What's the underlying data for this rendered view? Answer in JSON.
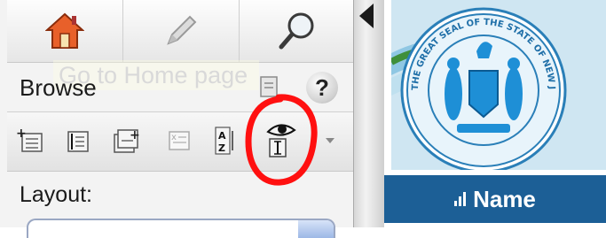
{
  "nav": {
    "home_icon": "home-icon",
    "edit_icon": "pencil-icon",
    "search_icon": "magnifier-icon"
  },
  "tooltip": {
    "text": "Go to Home page"
  },
  "browse": {
    "label": "Browse",
    "help": "?"
  },
  "toolbar": {
    "icons": [
      "new-record-icon",
      "edit-record-icon",
      "add-related-icon",
      "delete-record-icon",
      "sort-az-icon",
      "view-field-icon"
    ]
  },
  "layout": {
    "label": "Layout:"
  },
  "right": {
    "image": "state-seal-image",
    "column_header": "Name",
    "seal_text": "THE GREAT SEAL OF THE STATE OF NEW JERSEY"
  },
  "colors": {
    "header_blue": "#1c5f96",
    "annotation_red": "#ff0000"
  }
}
